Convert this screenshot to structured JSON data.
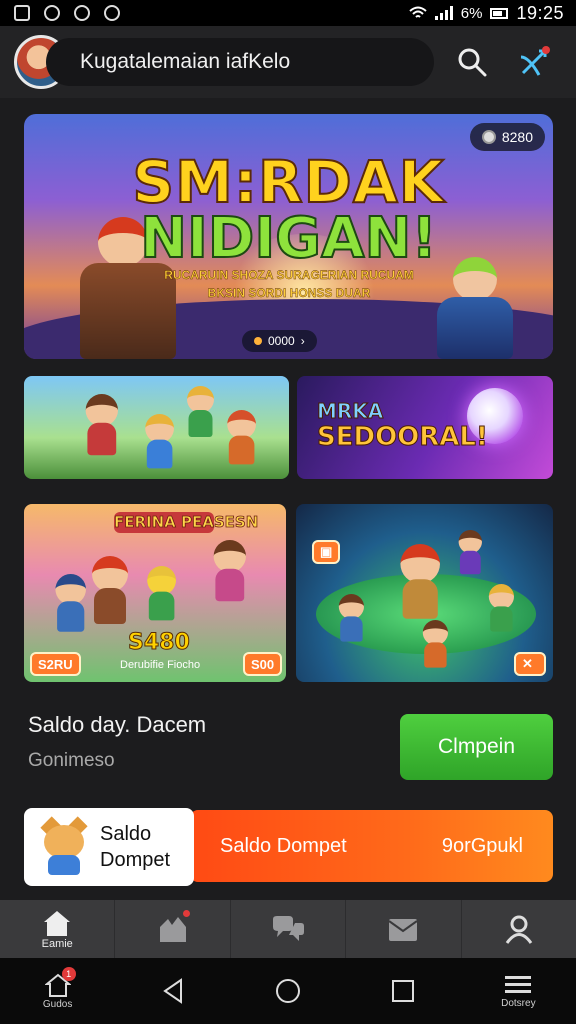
{
  "status_bar": {
    "battery": "6%",
    "time": "19:25"
  },
  "header": {
    "title": "Kugatalemaian iafKelo"
  },
  "hero": {
    "chip_text": "8280",
    "title_line1": "SM:RDAK",
    "title_line2": "NIDIGAN!",
    "subtitle_line1": "RUCARUIN SHOZA SURAGERIAN RUCUAM",
    "subtitle_line2": "BKSIN SORDI HONSS DUAR",
    "page_text": "0000"
  },
  "tiles": {
    "tile2_title_line1": "MRKA",
    "tile2_title_line2": "SEDOORAL!",
    "tile3_banner": "FERINA PEASESN",
    "tile3_price": "S480",
    "tile3_caption": "Derubifie Fiocho",
    "tile3_badge_left": "S2RU",
    "tile3_badge_right": "S00"
  },
  "saldo": {
    "label": "Saldo day. Dacem",
    "sub": "Gonimeso"
  },
  "buttons": {
    "primary": "Clmpein"
  },
  "wallet": {
    "card_label": "Saldo Dompet",
    "bar_label": "Saldo Dompet",
    "bar_value": "9orGpukl"
  },
  "bottom_nav": {
    "items": [
      {
        "label": "Eamie"
      },
      {
        "label": ""
      },
      {
        "label": ""
      },
      {
        "label": ""
      },
      {
        "label": ""
      }
    ]
  },
  "system_nav": {
    "home_label": "Gudos",
    "menu_label": "Dotsrey"
  },
  "colors": {
    "accent_green": "#34b02c",
    "accent_orange": "#ff5a18",
    "background": "#1c1c1e"
  }
}
